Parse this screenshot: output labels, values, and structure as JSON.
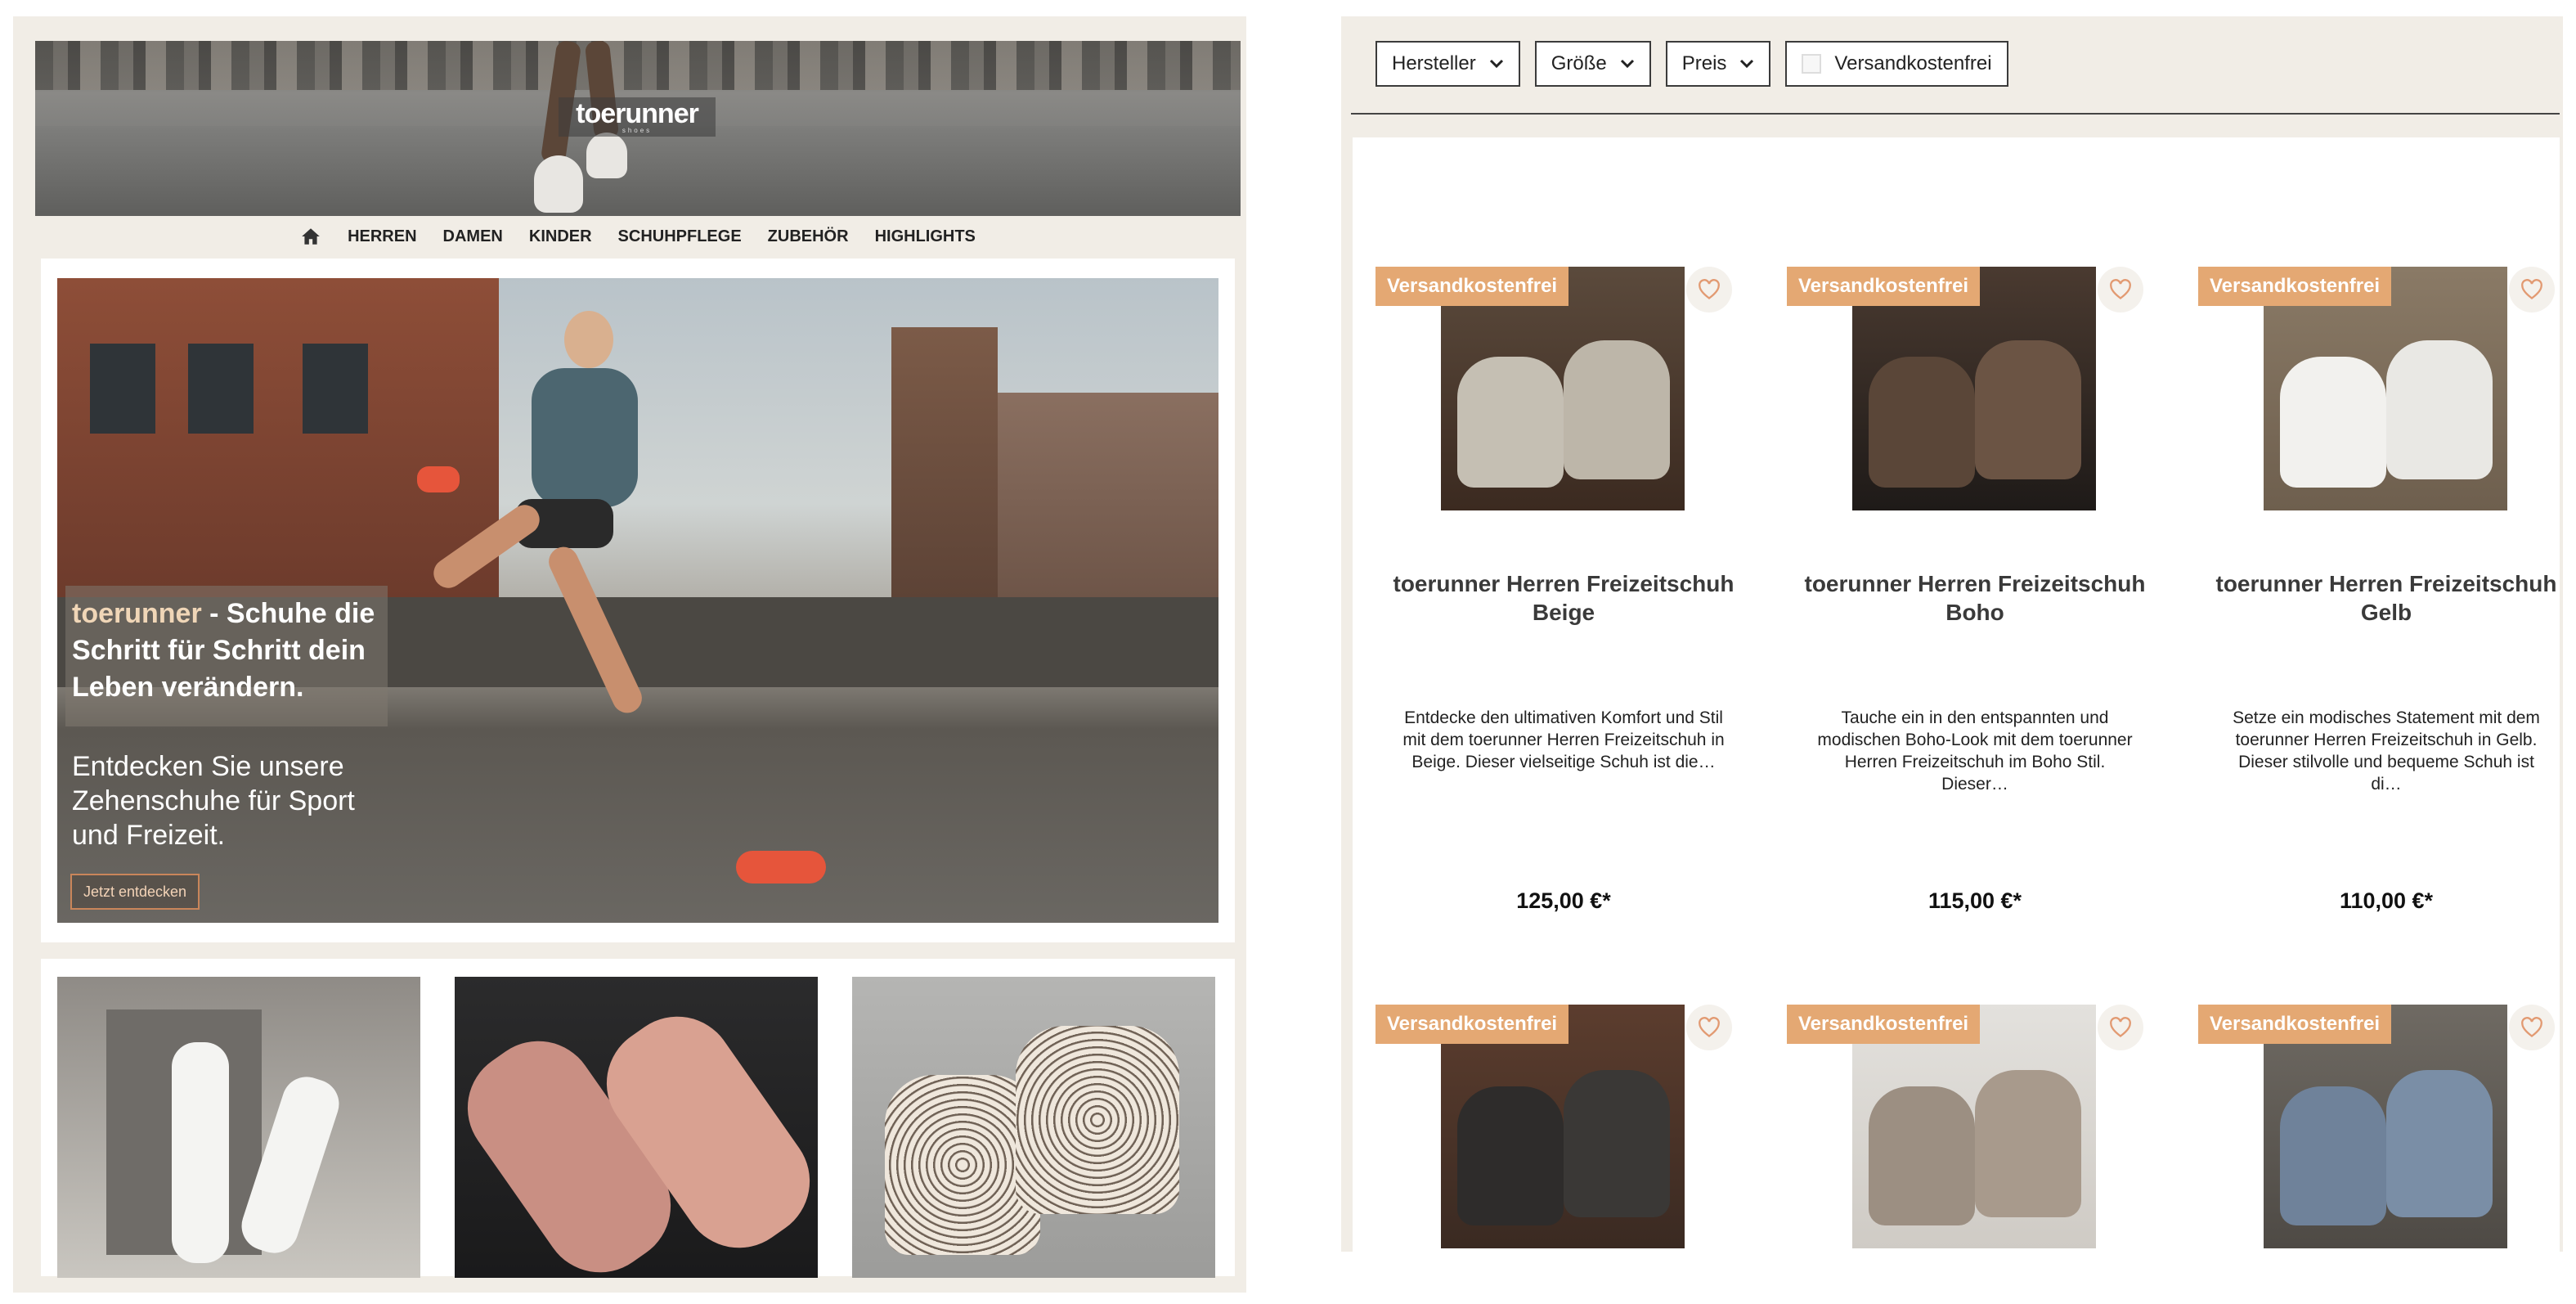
{
  "left": {
    "logo": {
      "text": "toerunner",
      "sub": "shoes"
    },
    "nav": {
      "items": [
        "HERREN",
        "DAMEN",
        "KINDER",
        "SCHUHPFLEGE",
        "ZUBEHÖR",
        "HIGHLIGHTS"
      ]
    },
    "hero": {
      "brand": "toerunner",
      "headline_rest": " - Schuhe die Schritt für Schritt dein Leben verändern.",
      "sub": "Entdecken Sie unsere Zehenschuhe für Sport und Freizeit.",
      "cta": "Jetzt entdecken"
    }
  },
  "filters": {
    "hersteller": "Hersteller",
    "groesse": "Größe",
    "preis": "Preis",
    "versand": "Versandkostenfrei"
  },
  "products": [
    {
      "badge": "Versandkostenfrei",
      "title": "toerunner Herren Freizeitschuh Beige",
      "desc": "Entdecke den ultimativen Komfort und Stil mit dem toerunner Herren Freizeitschuh in Beige. Dieser vielseitige Schuh ist die…",
      "price": "125,00 €*"
    },
    {
      "badge": "Versandkostenfrei",
      "title": "toerunner Herren Freizeitschuh Boho",
      "desc": "Tauche ein in den entspannten und modischen Boho-Look mit dem toerunner Herren Freizeitschuh im Boho Stil. Dieser…",
      "price": "115,00 €*"
    },
    {
      "badge": "Versandkostenfrei",
      "title": "toerunner Herren Freizeitschuh Gelb",
      "desc": "Setze ein modisches Statement mit dem toerunner Herren Freizeitschuh in Gelb. Dieser stilvolle und bequeme Schuh ist di…",
      "price": "110,00 €*"
    },
    {
      "badge": "Versandkostenfrei"
    },
    {
      "badge": "Versandkostenfrei"
    },
    {
      "badge": "Versandkostenfrei"
    }
  ],
  "colors": {
    "accent": "#e4a873",
    "panel_bg": "#f1ede6",
    "cta_border": "#c9855a"
  }
}
